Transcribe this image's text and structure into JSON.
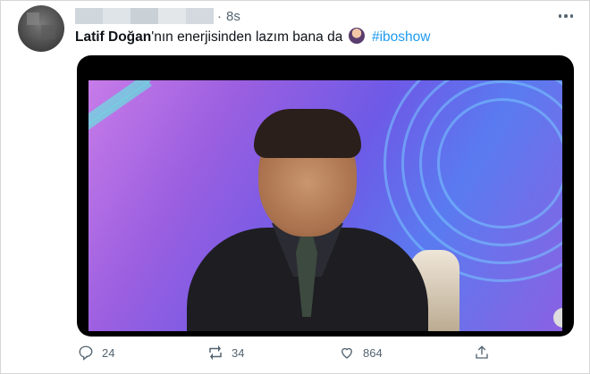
{
  "tweet": {
    "time": "8s",
    "author_mention": "Latif Doğan",
    "text_after_mention": "'nın enerjisinden lazım bana da",
    "emoji": "woman-shrugging-emoji",
    "hashtag": "#iboshow"
  },
  "actions": {
    "reply_count": "24",
    "retweet_count": "34",
    "like_count": "864"
  },
  "colors": {
    "hashtag": "#1d9bf0",
    "secondary_text": "#536471"
  }
}
